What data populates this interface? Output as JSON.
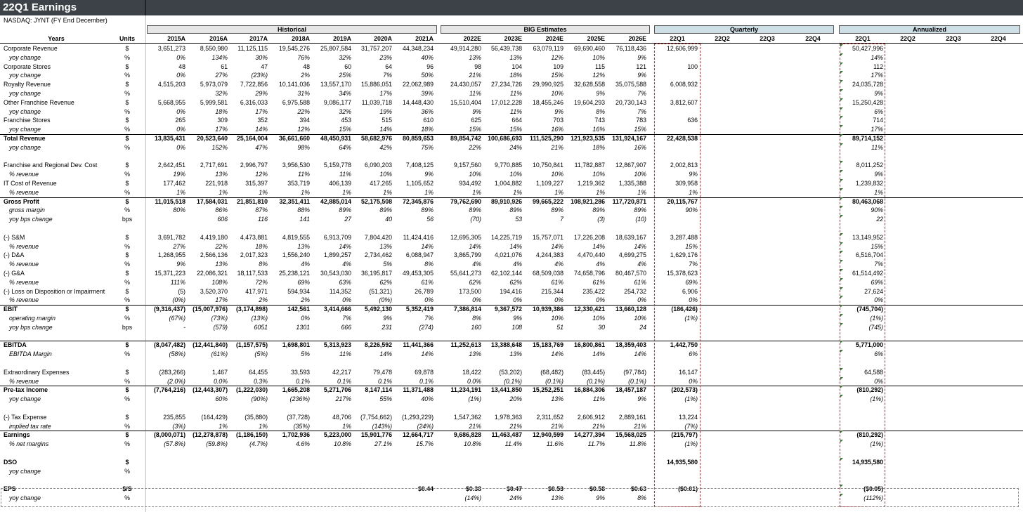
{
  "title": "22Q1 Earnings",
  "subtitle": "NASDAQ: JYNT (FY End December)",
  "groups": {
    "historical": "Historical",
    "estimates": "BIG Estimates",
    "quarterly": "Quarterly",
    "annualized": "Annualized"
  },
  "headers": {
    "years": "Years",
    "units": "Units",
    "cols": [
      "2015A",
      "2016A",
      "2017A",
      "2018A",
      "2019A",
      "2020A",
      "2021A",
      "2022E",
      "2023E",
      "2024E",
      "2025E",
      "2026E",
      "22Q1",
      "22Q2",
      "22Q3",
      "22Q4",
      "22Q1",
      "22Q2",
      "22Q3",
      "22Q4"
    ]
  },
  "rows": [
    {
      "label": "Corporate Revenue",
      "unit": "$",
      "values": [
        "3,651,273",
        "8,550,980",
        "11,125,115",
        "19,545,276",
        "25,807,584",
        "31,757,207",
        "44,348,234",
        "49,914,280",
        "56,439,738",
        "63,079,119",
        "69,690,460",
        "76,118,436",
        "12,606,999",
        "",
        "",
        "",
        "50,427,996",
        "",
        "",
        ""
      ]
    },
    {
      "label": "yoy change",
      "unit": "%",
      "sub": true,
      "values": [
        "0%",
        "134%",
        "30%",
        "76%",
        "32%",
        "23%",
        "40%",
        "13%",
        "13%",
        "12%",
        "10%",
        "9%",
        "",
        "",
        "",
        "",
        "14%",
        "",
        "",
        ""
      ]
    },
    {
      "label": "Corporate Stores",
      "unit": "$",
      "values": [
        "48",
        "61",
        "47",
        "48",
        "60",
        "64",
        "96",
        "98",
        "104",
        "109",
        "115",
        "121",
        "100",
        "",
        "",
        "",
        "112",
        "",
        "",
        ""
      ]
    },
    {
      "label": "yoy change",
      "unit": "%",
      "sub": true,
      "values": [
        "0%",
        "27%",
        "(23%)",
        "2%",
        "25%",
        "7%",
        "50%",
        "21%",
        "18%",
        "15%",
        "12%",
        "9%",
        "",
        "",
        "",
        "",
        "17%",
        "",
        "",
        ""
      ]
    },
    {
      "label": "Royalty Revenue",
      "unit": "$",
      "values": [
        "4,515,203",
        "5,973,079",
        "7,722,856",
        "10,141,036",
        "13,557,170",
        "15,886,051",
        "22,062,989",
        "24,430,057",
        "27,234,726",
        "29,990,925",
        "32,628,558",
        "35,075,588",
        "6,008,932",
        "",
        "",
        "",
        "24,035,728",
        "",
        "",
        ""
      ]
    },
    {
      "label": "yoy change",
      "unit": "%",
      "sub": true,
      "values": [
        "",
        "32%",
        "29%",
        "31%",
        "34%",
        "17%",
        "39%",
        "11%",
        "11%",
        "10%",
        "9%",
        "7%",
        "",
        "",
        "",
        "",
        "9%",
        "",
        "",
        ""
      ]
    },
    {
      "label": "Other Franchise Revenue",
      "unit": "$",
      "values": [
        "5,668,955",
        "5,999,581",
        "6,316,033",
        "6,975,588",
        "9,086,177",
        "11,039,718",
        "14,448,430",
        "15,510,404",
        "17,012,228",
        "18,455,246",
        "19,604,293",
        "20,730,143",
        "3,812,607",
        "",
        "",
        "",
        "15,250,428",
        "",
        "",
        ""
      ]
    },
    {
      "label": "yoy change",
      "unit": "%",
      "sub": true,
      "values": [
        "0%",
        "18%",
        "17%",
        "22%",
        "32%",
        "19%",
        "36%",
        "9%",
        "11%",
        "9%",
        "8%",
        "7%",
        "",
        "",
        "",
        "",
        "6%",
        "",
        "",
        ""
      ]
    },
    {
      "label": "Franchise Stores",
      "unit": "$",
      "values": [
        "265",
        "309",
        "352",
        "394",
        "453",
        "515",
        "610",
        "625",
        "664",
        "703",
        "743",
        "783",
        "636",
        "",
        "",
        "",
        "714",
        "",
        "",
        ""
      ]
    },
    {
      "label": "yoy change",
      "unit": "%",
      "sub": true,
      "values": [
        "0%",
        "17%",
        "14%",
        "12%",
        "15%",
        "14%",
        "18%",
        "15%",
        "15%",
        "16%",
        "16%",
        "15%",
        "",
        "",
        "",
        "",
        "17%",
        "",
        "",
        ""
      ]
    },
    {
      "label": "Total Revenue",
      "unit": "$",
      "bold": true,
      "line": true,
      "values": [
        "13,835,431",
        "20,523,640",
        "25,164,004",
        "36,661,660",
        "48,450,931",
        "58,682,976",
        "80,859,653",
        "89,854,742",
        "100,686,693",
        "111,525,290",
        "121,923,535",
        "131,924,167",
        "22,428,538",
        "",
        "",
        "",
        "89,714,152",
        "",
        "",
        ""
      ]
    },
    {
      "label": "yoy change",
      "unit": "%",
      "sub": true,
      "values": [
        "0%",
        "152%",
        "47%",
        "98%",
        "64%",
        "42%",
        "75%",
        "22%",
        "24%",
        "21%",
        "18%",
        "16%",
        "",
        "",
        "",
        "",
        "11%",
        "",
        "",
        ""
      ]
    },
    {
      "blank": true
    },
    {
      "label": "Franchise and Regional Dev. Cost",
      "unit": "$",
      "values": [
        "2,642,451",
        "2,717,691",
        "2,996,797",
        "3,956,530",
        "5,159,778",
        "6,090,203",
        "7,408,125",
        "9,157,560",
        "9,770,885",
        "10,750,841",
        "11,782,887",
        "12,867,907",
        "2,002,813",
        "",
        "",
        "",
        "8,011,252",
        "",
        "",
        ""
      ]
    },
    {
      "label": "% revenue",
      "unit": "%",
      "sub": true,
      "values": [
        "19%",
        "13%",
        "12%",
        "11%",
        "11%",
        "10%",
        "9%",
        "10%",
        "10%",
        "10%",
        "10%",
        "10%",
        "9%",
        "",
        "",
        "",
        "9%",
        "",
        "",
        ""
      ]
    },
    {
      "label": "IT Cost of Revenue",
      "unit": "$",
      "values": [
        "177,462",
        "221,918",
        "315,397",
        "353,719",
        "406,139",
        "417,265",
        "1,105,652",
        "934,492",
        "1,004,882",
        "1,109,227",
        "1,219,362",
        "1,335,388",
        "309,958",
        "",
        "",
        "",
        "1,239,832",
        "",
        "",
        ""
      ]
    },
    {
      "label": "% revenue",
      "unit": "%",
      "sub": true,
      "values": [
        "1%",
        "1%",
        "1%",
        "1%",
        "1%",
        "1%",
        "1%",
        "1%",
        "1%",
        "1%",
        "1%",
        "1%",
        "1%",
        "",
        "",
        "",
        "1%",
        "",
        "",
        ""
      ]
    },
    {
      "label": "Gross Profit",
      "unit": "$",
      "bold": true,
      "line": true,
      "values": [
        "11,015,518",
        "17,584,031",
        "21,851,810",
        "32,351,411",
        "42,885,014",
        "52,175,508",
        "72,345,876",
        "79,762,690",
        "89,910,926",
        "99,665,222",
        "108,921,286",
        "117,720,871",
        "20,115,767",
        "",
        "",
        "",
        "80,463,068",
        "",
        "",
        ""
      ]
    },
    {
      "label": "gross margin",
      "unit": "%",
      "sub": true,
      "values": [
        "80%",
        "86%",
        "87%",
        "88%",
        "89%",
        "89%",
        "89%",
        "89%",
        "89%",
        "89%",
        "89%",
        "89%",
        "90%",
        "",
        "",
        "",
        "90%",
        "",
        "",
        ""
      ]
    },
    {
      "label": "yoy bps change",
      "unit": "bps",
      "sub": true,
      "values": [
        "",
        "606",
        "116",
        "141",
        "27",
        "40",
        "56",
        "(70)",
        "53",
        "7",
        "(3)",
        "(10)",
        "",
        "",
        "",
        "",
        "22",
        "",
        "",
        ""
      ]
    },
    {
      "blank": true
    },
    {
      "label": "(-) S&M",
      "unit": "$",
      "values": [
        "3,691,782",
        "4,419,180",
        "4,473,881",
        "4,819,555",
        "6,913,709",
        "7,804,420",
        "11,424,416",
        "12,695,305",
        "14,225,719",
        "15,757,071",
        "17,226,208",
        "18,639,167",
        "3,287,488",
        "",
        "",
        "",
        "13,149,952",
        "",
        "",
        ""
      ]
    },
    {
      "label": "% revenue",
      "unit": "%",
      "sub": true,
      "values": [
        "27%",
        "22%",
        "18%",
        "13%",
        "14%",
        "13%",
        "14%",
        "14%",
        "14%",
        "14%",
        "14%",
        "14%",
        "15%",
        "",
        "",
        "",
        "15%",
        "",
        "",
        ""
      ]
    },
    {
      "label": "(-) D&A",
      "unit": "$",
      "values": [
        "1,268,955",
        "2,566,136",
        "2,017,323",
        "1,556,240",
        "1,899,257",
        "2,734,462",
        "6,088,947",
        "3,865,799",
        "4,021,076",
        "4,244,383",
        "4,470,440",
        "4,699,275",
        "1,629,176",
        "",
        "",
        "",
        "6,516,704",
        "",
        "",
        ""
      ]
    },
    {
      "label": "% revenue",
      "unit": "%",
      "sub": true,
      "values": [
        "9%",
        "13%",
        "8%",
        "4%",
        "4%",
        "5%",
        "8%",
        "4%",
        "4%",
        "4%",
        "4%",
        "4%",
        "7%",
        "",
        "",
        "",
        "7%",
        "",
        "",
        ""
      ]
    },
    {
      "label": "(-) G&A",
      "unit": "$",
      "values": [
        "15,371,223",
        "22,086,321",
        "18,117,533",
        "25,238,121",
        "30,543,030",
        "36,195,817",
        "49,453,305",
        "55,641,273",
        "62,102,144",
        "68,509,038",
        "74,658,796",
        "80,467,570",
        "15,378,623",
        "",
        "",
        "",
        "61,514,492",
        "",
        "",
        ""
      ]
    },
    {
      "label": "% revenue",
      "unit": "%",
      "sub": true,
      "values": [
        "111%",
        "108%",
        "72%",
        "69%",
        "63%",
        "62%",
        "61%",
        "62%",
        "62%",
        "61%",
        "61%",
        "61%",
        "69%",
        "",
        "",
        "",
        "69%",
        "",
        "",
        ""
      ]
    },
    {
      "label": "(-) Loss on Disposition or Impairment",
      "unit": "$",
      "values": [
        "(5)",
        "3,520,370",
        "417,971",
        "594,934",
        "114,352",
        "(51,321)",
        "26,789",
        "173,500",
        "194,416",
        "215,344",
        "235,422",
        "254,732",
        "6,906",
        "",
        "",
        "",
        "27,624",
        "",
        "",
        ""
      ]
    },
    {
      "label": "% revenue",
      "unit": "%",
      "sub": true,
      "values": [
        "(0%)",
        "17%",
        "2%",
        "2%",
        "0%",
        "(0%)",
        "0%",
        "0%",
        "0%",
        "0%",
        "0%",
        "0%",
        "0%",
        "",
        "",
        "",
        "0%",
        "",
        "",
        ""
      ]
    },
    {
      "label": "EBIT",
      "unit": "$",
      "bold": true,
      "line": true,
      "values": [
        "(9,316,437)",
        "(15,007,976)",
        "(3,174,898)",
        "142,561",
        "3,414,666",
        "5,492,130",
        "5,352,419",
        "7,386,814",
        "9,367,572",
        "10,939,386",
        "12,330,421",
        "13,660,128",
        "(186,426)",
        "",
        "",
        "",
        "(745,704)",
        "",
        "",
        ""
      ]
    },
    {
      "label": "operating margin",
      "unit": "%",
      "sub": true,
      "values": [
        "(67%)",
        "(73%)",
        "(13%)",
        "0%",
        "7%",
        "9%",
        "7%",
        "8%",
        "9%",
        "10%",
        "10%",
        "10%",
        "(1%)",
        "",
        "",
        "",
        "(1%)",
        "",
        "",
        ""
      ]
    },
    {
      "label": "yoy bps change",
      "unit": "bps",
      "sub": true,
      "values": [
        "-",
        "(579)",
        "6051",
        "1301",
        "666",
        "231",
        "(274)",
        "160",
        "108",
        "51",
        "30",
        "24",
        "",
        "",
        "",
        "",
        "(745)",
        "",
        "",
        ""
      ]
    },
    {
      "blank": true
    },
    {
      "label": "EBITDA",
      "unit": "$",
      "bold": true,
      "line": true,
      "values": [
        "(8,047,482)",
        "(12,441,840)",
        "(1,157,575)",
        "1,698,801",
        "5,313,923",
        "8,226,592",
        "11,441,366",
        "11,252,613",
        "13,388,648",
        "15,183,769",
        "16,800,861",
        "18,359,403",
        "1,442,750",
        "",
        "",
        "",
        "5,771,000",
        "",
        "",
        ""
      ]
    },
    {
      "label": "EBITDA Margin",
      "unit": "%",
      "sub": true,
      "values": [
        "(58%)",
        "(61%)",
        "(5%)",
        "5%",
        "11%",
        "14%",
        "14%",
        "13%",
        "13%",
        "14%",
        "14%",
        "14%",
        "6%",
        "",
        "",
        "",
        "6%",
        "",
        "",
        ""
      ]
    },
    {
      "blank": true
    },
    {
      "label": "Extraordinary Expenses",
      "unit": "$",
      "values": [
        "(283,266)",
        "1,467",
        "64,455",
        "33,593",
        "42,217",
        "79,478",
        "69,878",
        "18,422",
        "(53,202)",
        "(68,482)",
        "(83,445)",
        "(97,784)",
        "16,147",
        "",
        "",
        "",
        "64,588",
        "",
        "",
        ""
      ]
    },
    {
      "label": "% revenue",
      "unit": "%",
      "sub": true,
      "values": [
        "(2.0%)",
        "0.0%",
        "0.3%",
        "0.1%",
        "0.1%",
        "0.1%",
        "0.1%",
        "0.0%",
        "(0.1%)",
        "(0.1%)",
        "(0.1%)",
        "(0.1%)",
        "0%",
        "",
        "",
        "",
        "0%",
        "",
        "",
        ""
      ]
    },
    {
      "label": "Pre-tax Income",
      "unit": "$",
      "bold": true,
      "line": true,
      "values": [
        "(7,764,216)",
        "(12,443,307)",
        "(1,222,030)",
        "1,665,208",
        "5,271,706",
        "8,147,114",
        "11,371,488",
        "11,234,191",
        "13,441,850",
        "15,252,251",
        "16,884,306",
        "18,457,187",
        "(202,573)",
        "",
        "",
        "",
        "(810,292)",
        "",
        "",
        ""
      ]
    },
    {
      "label": "yoy change",
      "unit": "%",
      "sub": true,
      "values": [
        "",
        "60%",
        "(90%)",
        "(236%)",
        "217%",
        "55%",
        "40%",
        "(1%)",
        "20%",
        "13%",
        "11%",
        "9%",
        "(1%)",
        "",
        "",
        "",
        "(1%)",
        "",
        "",
        ""
      ]
    },
    {
      "blank": true
    },
    {
      "label": "(-) Tax Expense",
      "unit": "$",
      "values": [
        "235,855",
        "(164,429)",
        "(35,880)",
        "(37,728)",
        "48,706",
        "(7,754,662)",
        "(1,293,229)",
        "1,547,362",
        "1,978,363",
        "2,311,652",
        "2,606,912",
        "2,889,161",
        "13,224",
        "",
        "",
        "",
        "",
        "",
        "",
        ""
      ]
    },
    {
      "label": "implied tax rate",
      "unit": "%",
      "sub": true,
      "values": [
        "(3%)",
        "1%",
        "1%",
        "(35%)",
        "1%",
        "(143%)",
        "(24%)",
        "21%",
        "21%",
        "21%",
        "21%",
        "21%",
        "(7%)",
        "",
        "",
        "",
        "",
        "",
        "",
        ""
      ]
    },
    {
      "label": "Earnings",
      "unit": "$",
      "bold": true,
      "line": true,
      "values": [
        "(8,000,071)",
        "(12,278,878)",
        "(1,186,150)",
        "1,702,936",
        "5,223,000",
        "15,901,776",
        "12,664,717",
        "9,686,828",
        "11,463,487",
        "12,940,599",
        "14,277,394",
        "15,568,025",
        "(215,797)",
        "",
        "",
        "",
        "(810,292)",
        "",
        "",
        ""
      ]
    },
    {
      "label": "% net margins",
      "unit": "%",
      "sub": true,
      "values": [
        "(57.8%)",
        "(59.8%)",
        "(4.7%)",
        "4.6%",
        "10.8%",
        "27.1%",
        "15.7%",
        "10.8%",
        "11.4%",
        "11.6%",
        "11.7%",
        "11.8%",
        "(1%)",
        "",
        "",
        "",
        "(1%)",
        "",
        "",
        ""
      ]
    },
    {
      "blank": true
    },
    {
      "label": "DSO",
      "unit": "$",
      "bold": true,
      "values": [
        "",
        "",
        "",
        "",
        "",
        "",
        "",
        "",
        "",
        "",
        "",
        "",
        "14,935,580",
        "",
        "",
        "",
        "14,935,580",
        "",
        "",
        ""
      ]
    },
    {
      "label": "yoy change",
      "unit": "%",
      "sub": true,
      "values": [
        "",
        "",
        "",
        "",
        "",
        "",
        "",
        "",
        "",
        "",
        "",
        "",
        "",
        "",
        "",
        "",
        "",
        "",
        "",
        ""
      ]
    },
    {
      "blank": true
    },
    {
      "label": "EPS",
      "unit": "$/S",
      "bold": true,
      "values": [
        "",
        "",
        "",
        "",
        "",
        "",
        "$0.44",
        "$0.38",
        "$0.47",
        "$0.53",
        "$0.58",
        "$0.63",
        "($0.01)",
        "",
        "",
        "",
        "($0.05)",
        "",
        "",
        ""
      ]
    },
    {
      "label": "yoy change",
      "unit": "%",
      "sub": true,
      "values": [
        "",
        "",
        "",
        "",
        "",
        "",
        "",
        "(14%)",
        "24%",
        "13%",
        "9%",
        "8%",
        "",
        "",
        "",
        "",
        "(112%)",
        "",
        "",
        ""
      ]
    }
  ]
}
